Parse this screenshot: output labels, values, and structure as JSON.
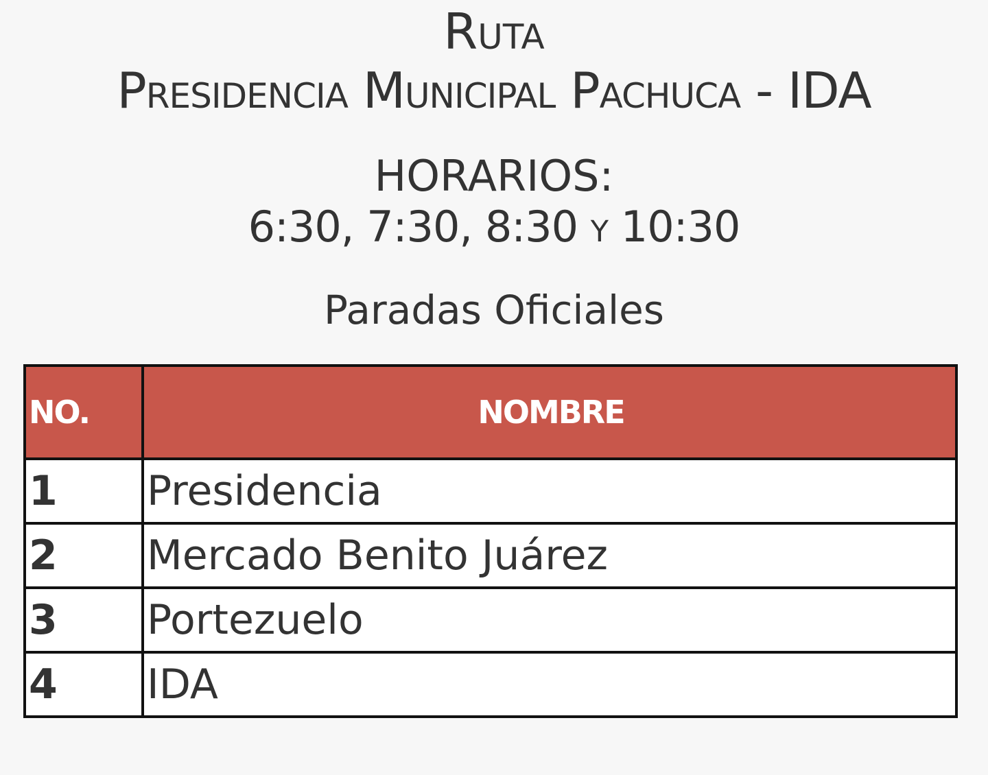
{
  "header": {
    "route_label": "Ruta",
    "route_name": "Presidencia Municipal Pachuca - IDA"
  },
  "schedule": {
    "heading": "HORARIOS:",
    "times": "6:30, 7:30, 8:30 y 10:30"
  },
  "stops": {
    "heading": "Paradas Oficiales",
    "columns": [
      "NO.",
      "NOMBRE"
    ],
    "rows": [
      {
        "no": "1",
        "name": "Presidencia"
      },
      {
        "no": "2",
        "name": "Mercado Benito Juárez"
      },
      {
        "no": "3",
        "name": "Portezuelo"
      },
      {
        "no": "4",
        "name": "IDA"
      }
    ]
  },
  "colors": {
    "header_fill": "#c8574b",
    "header_text": "#ffffff",
    "border": "#111111",
    "background": "#f7f7f7",
    "text": "#333333"
  }
}
